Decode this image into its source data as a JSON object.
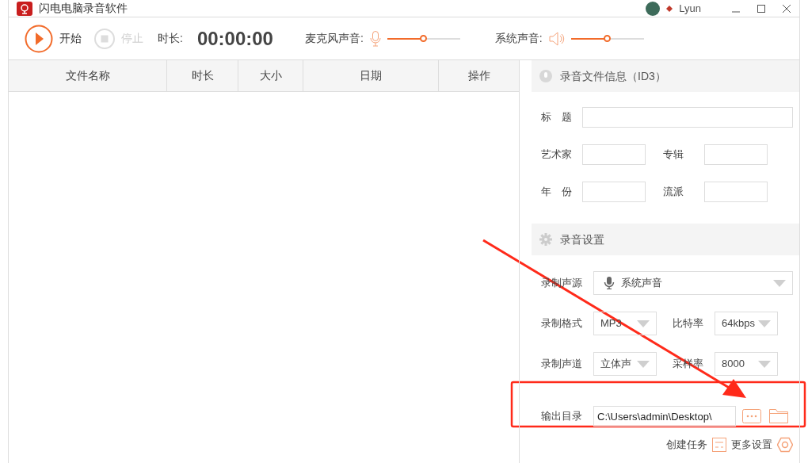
{
  "window": {
    "title": "闪电电脑录音软件",
    "user": "Lyun"
  },
  "toolbar": {
    "start": {
      "label": "开始",
      "disabled": false
    },
    "stop": {
      "label": "停止",
      "disabled": true
    },
    "duration_label": "时长:",
    "duration": "00:00:00",
    "mic": {
      "label": "麦克风声音:",
      "level": 0.49
    },
    "system": {
      "label": "系统声音:",
      "level": 0.49
    }
  },
  "table": {
    "columns": [
      "文件名称",
      "时长",
      "大小",
      "日期",
      "操作"
    ]
  },
  "id3": {
    "title": "录音文件信息（ID3）",
    "rows": [
      [
        {
          "label": "标　题"
        }
      ],
      [
        {
          "label": "艺术家"
        },
        {
          "label": "专辑"
        }
      ],
      [
        {
          "label": "年　份"
        },
        {
          "label": "流派"
        }
      ]
    ]
  },
  "settings": {
    "title": "录音设置",
    "source": {
      "label": "录制声源",
      "value": "系统声音"
    },
    "rows": [
      [
        {
          "label": "录制格式",
          "value": "MP3"
        },
        {
          "label": "比特率",
          "value": "64kbps"
        }
      ],
      [
        {
          "label": "录制声道",
          "value": "立体声"
        },
        {
          "label": "采样率",
          "value": "8000"
        }
      ]
    ],
    "output": {
      "label": "输出目录",
      "value": "C:\\Users\\admin\\Desktop\\"
    }
  },
  "footer": [
    "创建任务",
    "更多设置"
  ]
}
